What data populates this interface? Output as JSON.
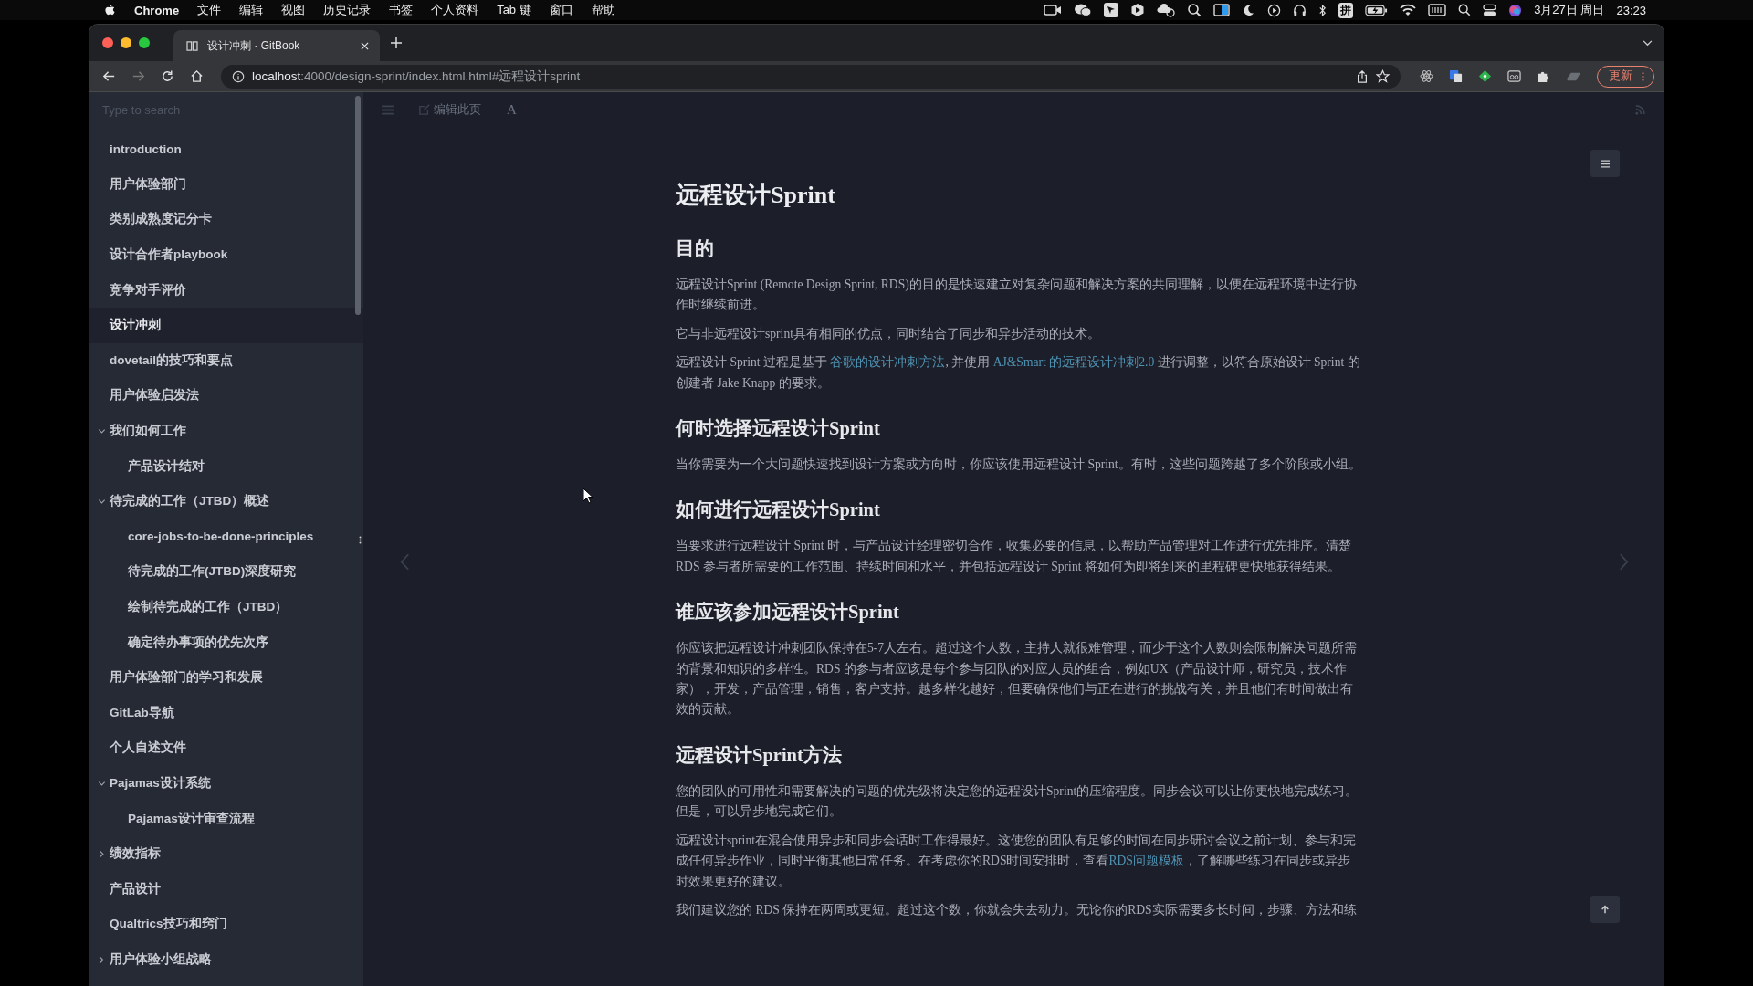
{
  "menu_bar": {
    "app": "Chrome",
    "menus": [
      "文件",
      "编辑",
      "视图",
      "历史记录",
      "书签",
      "个人资料",
      "Tab 键",
      "窗口",
      "帮助"
    ],
    "input_method": "拼",
    "date": "3月27日 周日",
    "time": "23:23"
  },
  "browser": {
    "tab_title": "设计冲刺 · GitBook",
    "url_host": "localhost",
    "url_path": ":4000/design-sprint/index.html.html#远程设计sprint",
    "update_button": "更新"
  },
  "sidebar": {
    "search_placeholder": "Type to search",
    "items": [
      {
        "label": "introduction",
        "selected": false
      },
      {
        "label": "用户体验部门",
        "selected": false
      },
      {
        "label": "类别成熟度记分卡",
        "selected": false
      },
      {
        "label": "设计合作者playbook",
        "selected": false
      },
      {
        "label": "竞争对手评价",
        "selected": false
      },
      {
        "label": "设计冲刺",
        "selected": true
      },
      {
        "label": "dovetail的技巧和要点",
        "selected": false
      },
      {
        "label": "用户体验启发法",
        "selected": false
      },
      {
        "label": "我们如何工作",
        "selected": false,
        "expanded": true,
        "children": [
          {
            "label": "产品设计结对",
            "selected": false
          }
        ]
      },
      {
        "label": "待完成的工作（JTBD）概述",
        "selected": false,
        "expanded": true,
        "children": [
          {
            "label": "core-jobs-to-be-done-principles",
            "selected": false
          },
          {
            "label": "待完成的工作(JTBD)深度研究",
            "selected": false
          },
          {
            "label": "绘制待完成的工作（JTBD）",
            "selected": false
          },
          {
            "label": "确定待办事项的优先次序",
            "selected": false
          }
        ]
      },
      {
        "label": "用户体验部门的学习和发展",
        "selected": false
      },
      {
        "label": "GitLab导航",
        "selected": false
      },
      {
        "label": "个人自述文件",
        "selected": false
      },
      {
        "label": "Pajamas设计系统",
        "selected": false,
        "expanded": true,
        "children": [
          {
            "label": "Pajamas设计审查流程",
            "selected": false
          }
        ]
      },
      {
        "label": "绩效指标",
        "selected": false,
        "expanded": false
      },
      {
        "label": "产品设计",
        "selected": false
      },
      {
        "label": "Qualtrics技巧和窍门",
        "selected": false
      },
      {
        "label": "用户体验小组战略",
        "selected": false,
        "expanded": false
      }
    ]
  },
  "toolbar": {
    "edit_label": "编辑此页",
    "font_button": "A"
  },
  "article": [
    {
      "kind": "title",
      "text": "远程设计Sprint"
    },
    {
      "kind": "heading",
      "text": "目的"
    },
    {
      "kind": "paragraph",
      "parts": [
        {
          "text": "远程设计Sprint (Remote Design Sprint, RDS)的目的是快速建立对复杂问题和解决方案的共同理解，以便在远程环境中进行协作时继续前进。",
          "link": false
        }
      ]
    },
    {
      "kind": "paragraph",
      "parts": [
        {
          "text": "它与非远程设计sprint具有相同的优点，同时结合了同步和异步活动的技术。",
          "link": false
        }
      ]
    },
    {
      "kind": "paragraph",
      "parts": [
        {
          "text": "远程设计 Sprint 过程是基于 ",
          "link": false
        },
        {
          "text": "谷歌的设计冲刺方法",
          "link": true
        },
        {
          "text": ", 并使用 ",
          "link": false
        },
        {
          "text": "AJ&Smart 的远程设计冲刺2.0",
          "link": true
        },
        {
          "text": " 进行调整，以符合原始设计 Sprint 的创建者 Jake Knapp 的要求。",
          "link": false
        }
      ]
    },
    {
      "kind": "heading",
      "text": "何时选择远程设计Sprint"
    },
    {
      "kind": "paragraph",
      "parts": [
        {
          "text": "当你需要为一个大问题快速找到设计方案或方向时，你应该使用远程设计 Sprint。有时，这些问题跨越了多个阶段或小组。",
          "link": false
        }
      ]
    },
    {
      "kind": "heading",
      "text": "如何进行远程设计Sprint"
    },
    {
      "kind": "paragraph",
      "parts": [
        {
          "text": "当要求进行远程设计 Sprint 时，与产品设计经理密切合作，收集必要的信息，以帮助产品管理对工作进行优先排序。清楚 RDS 参与者所需要的工作范围、持续时间和水平，并包括远程设计 Sprint 将如何为即将到来的里程碑更快地获得结果。",
          "link": false
        }
      ]
    },
    {
      "kind": "heading",
      "text": "谁应该参加远程设计Sprint"
    },
    {
      "kind": "paragraph",
      "parts": [
        {
          "text": "你应该把远程设计冲刺团队保持在5-7人左右。超过这个人数，主持人就很难管理，而少于这个人数则会限制解决问题所需的背景和知识的多样性。RDS 的参与者应该是每个参与团队的对应人员的组合，例如UX（产品设计师，研究员，技术作家），开发，产品管理，销售，客户支持。越多样化越好，但要确保他们与正在进行的挑战有关，并且他们有时间做出有效的贡献。",
          "link": false
        }
      ]
    },
    {
      "kind": "heading",
      "text": "远程设计Sprint方法"
    },
    {
      "kind": "paragraph",
      "parts": [
        {
          "text": "您的团队的可用性和需要解决的问题的优先级将决定您的远程设计Sprint的压缩程度。同步会议可以让你更快地完成练习。但是，可以异步地完成它们。",
          "link": false
        }
      ]
    },
    {
      "kind": "paragraph",
      "parts": [
        {
          "text": "远程设计sprint在混合使用异步和同步会话时工作得最好。这使您的团队有足够的时间在同步研讨会议之前计划、参与和完成任何异步作业，同时平衡其他日常任务。在考虑你的RDS时间安排时，查看",
          "link": false
        },
        {
          "text": "RDS问题模板",
          "link": true
        },
        {
          "text": "，了解哪些练习在同步或异步时效果更好的建议。",
          "link": false
        }
      ]
    },
    {
      "kind": "paragraph",
      "parts": [
        {
          "text": "我们建议您的 RDS 保持在两周或更短。超过这个数，你就会失去动力。无论你的RDS实际需要多长时间，步骤、方法和练",
          "link": false
        }
      ]
    }
  ]
}
